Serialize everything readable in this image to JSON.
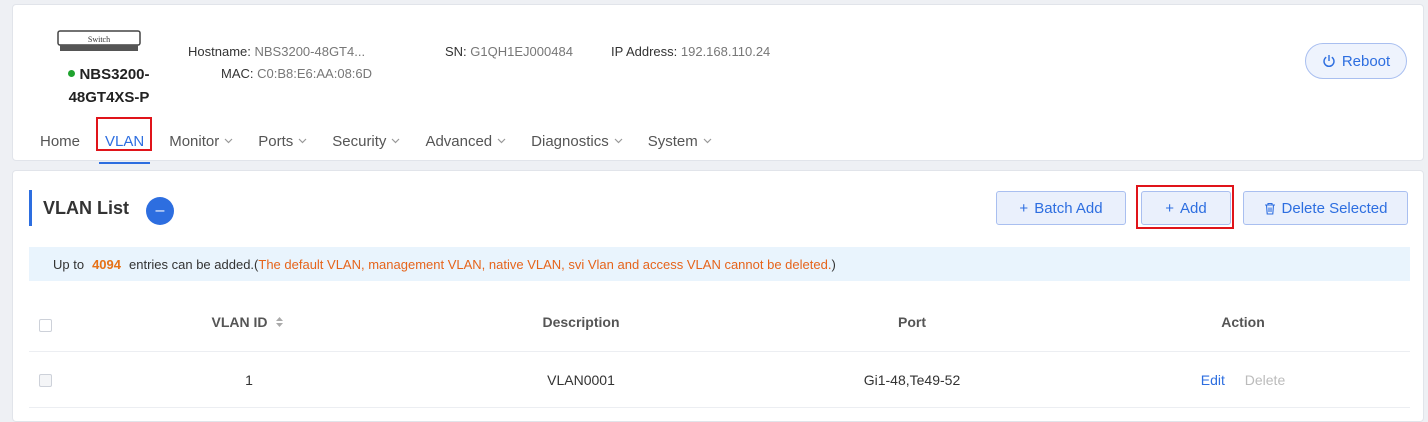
{
  "device": {
    "icon_label": "Switch",
    "name_line1": "NBS3200-",
    "name_line2": "48GT4XS-P",
    "status_color": "#1fa32f",
    "hostname_label": "Hostname:",
    "hostname_value": "NBS3200-48GT4...",
    "mac_label": "MAC:",
    "mac_value": "C0:B8:E6:AA:08:6D",
    "sn_label": "SN:",
    "sn_value": "G1QH1EJ000484",
    "ip_label": "IP Address:",
    "ip_value": "192.168.110.24",
    "reboot_label": "Reboot"
  },
  "nav": {
    "items": [
      {
        "label": "Home"
      },
      {
        "label": "VLAN"
      },
      {
        "label": "Monitor"
      },
      {
        "label": "Ports"
      },
      {
        "label": "Security"
      },
      {
        "label": "Advanced"
      },
      {
        "label": "Diagnostics"
      },
      {
        "label": "System"
      }
    ],
    "active": "VLAN"
  },
  "vlan_list": {
    "title": "VLAN List",
    "collapse_symbol": "–",
    "batch_add_label": "Batch Add",
    "add_label": "Add",
    "delete_selected_label": "Delete Selected",
    "notice_prefix": "Up to",
    "notice_count": "4094",
    "notice_middle": "entries can be added.(",
    "notice_warning": "The default VLAN, management VLAN, native VLAN, svi Vlan and access VLAN cannot be deleted.",
    "notice_suffix": ")",
    "columns": {
      "vlan_id": "VLAN ID",
      "description": "Description",
      "port": "Port",
      "action": "Action"
    },
    "rows": [
      {
        "vlan_id": "1",
        "description": "VLAN0001",
        "port": "Gi1-48,Te49-52",
        "edit": "Edit",
        "delete": "Delete"
      }
    ]
  },
  "colors": {
    "accent": "#2d6ee0",
    "highlight_box": "#e0141a",
    "warning_text": "#e6641b"
  }
}
